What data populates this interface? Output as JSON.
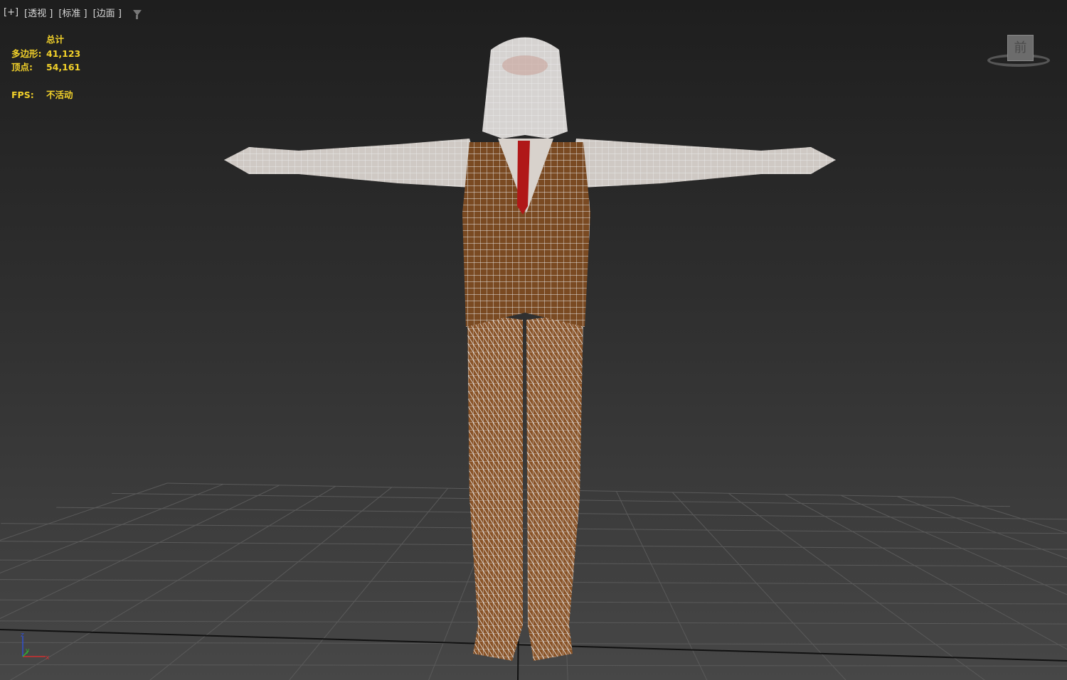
{
  "viewport": {
    "labels": [
      "[+]",
      "[透视 ]",
      "[标准 ]",
      "[边面 ]"
    ],
    "filter_icon": "filter-icon",
    "stats": {
      "header": "总计",
      "polygons_label": "多边形:",
      "polygons_value": "41,123",
      "vertices_label": "顶点:",
      "vertices_value": "54,161",
      "fps_label": "FPS:",
      "fps_value": "不活动"
    },
    "viewcube": {
      "face": "前"
    },
    "axis": {
      "z": "z",
      "y": "y",
      "x": "x"
    }
  },
  "colors": {
    "stats": "#f2d12a",
    "vest": "#7a4a22",
    "wire": "#e8e8e8",
    "tie": "#b01818"
  }
}
